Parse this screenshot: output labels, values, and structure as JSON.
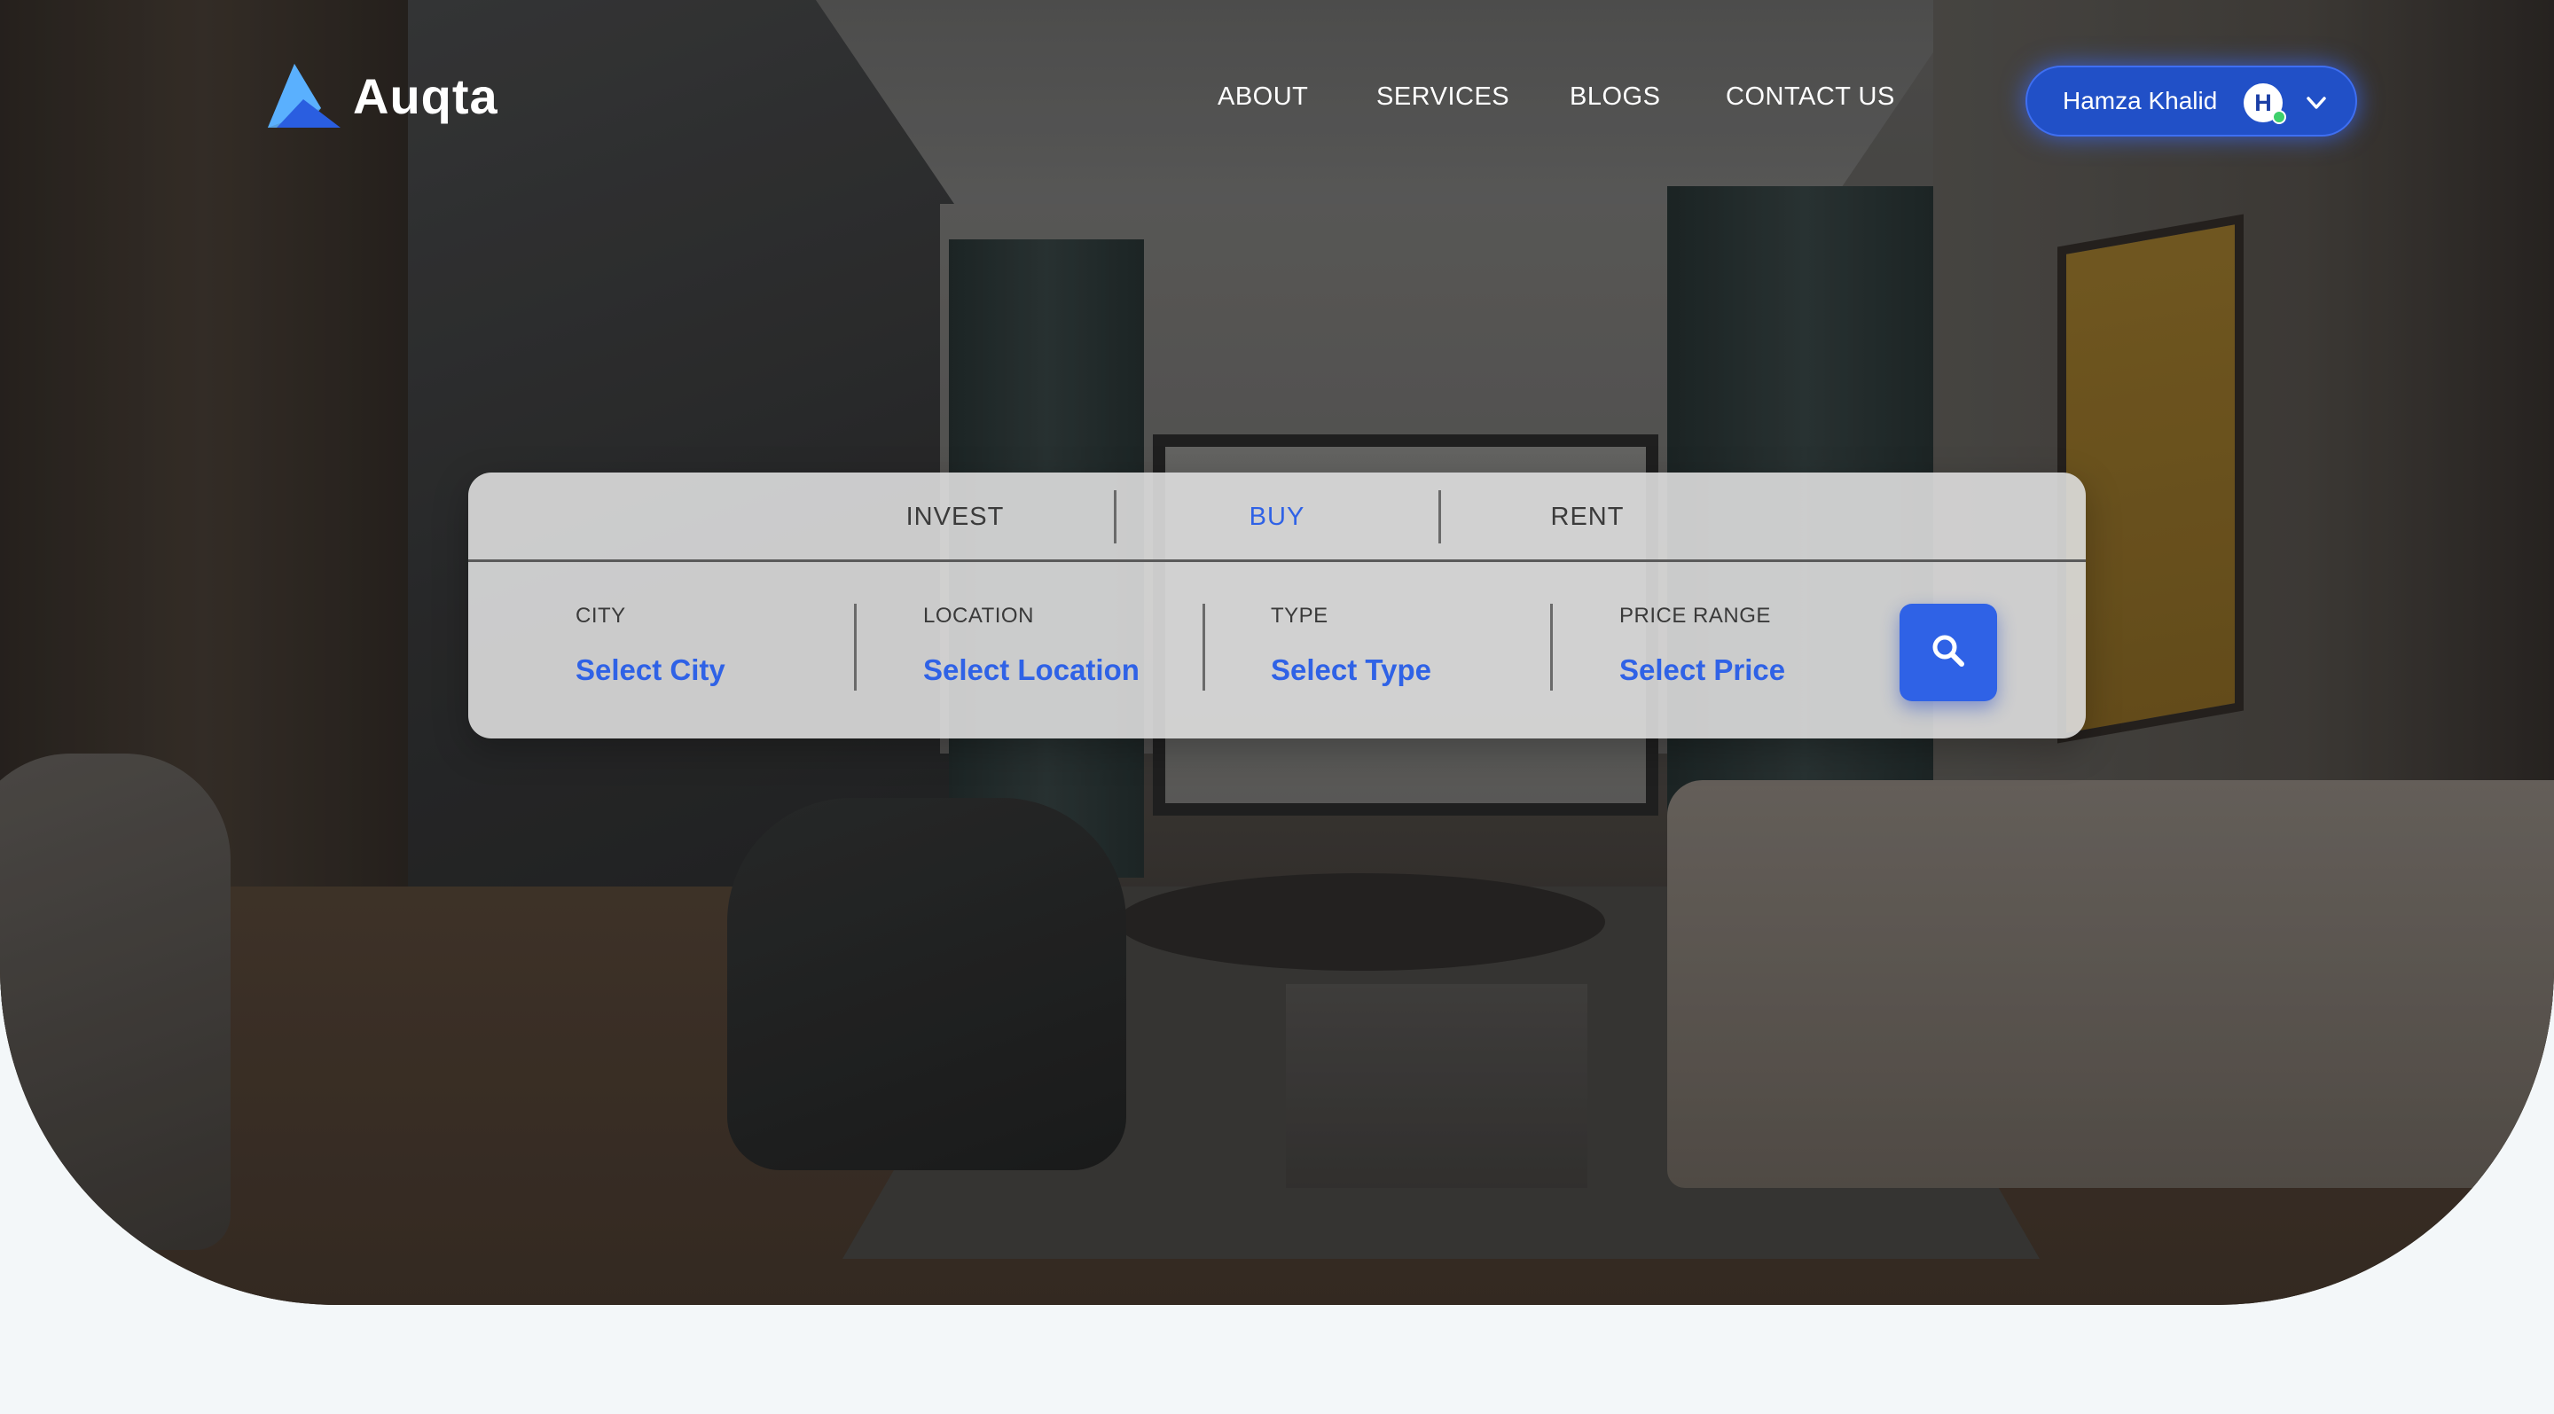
{
  "brand": {
    "name": "Auqta",
    "logo_icon": "triangle-logo-icon"
  },
  "nav": {
    "items": [
      {
        "label": "ABOUT"
      },
      {
        "label": "SERVICES"
      },
      {
        "label": "BLOGS"
      },
      {
        "label": "CONTACT US"
      }
    ]
  },
  "user": {
    "name": "Hamza Khalid",
    "avatar_initial": "H",
    "online_status_icon": "online-dot-icon",
    "dropdown_icon": "chevron-down-icon"
  },
  "search": {
    "tabs": [
      {
        "label": "INVEST",
        "active": false
      },
      {
        "label": "BUY",
        "active": true
      },
      {
        "label": "RENT",
        "active": false
      }
    ],
    "fields": [
      {
        "label": "CITY",
        "value": "Select City"
      },
      {
        "label": "LOCATION",
        "value": "Select Location"
      },
      {
        "label": "TYPE",
        "value": "Select Type"
      },
      {
        "label": "PRICE RANGE",
        "value": "Select Price"
      }
    ],
    "button_icon": "search-icon"
  },
  "colors": {
    "accent": "#2f62e6",
    "pill_bg": "#2150c7",
    "page_bg": "#f3f7f9"
  }
}
